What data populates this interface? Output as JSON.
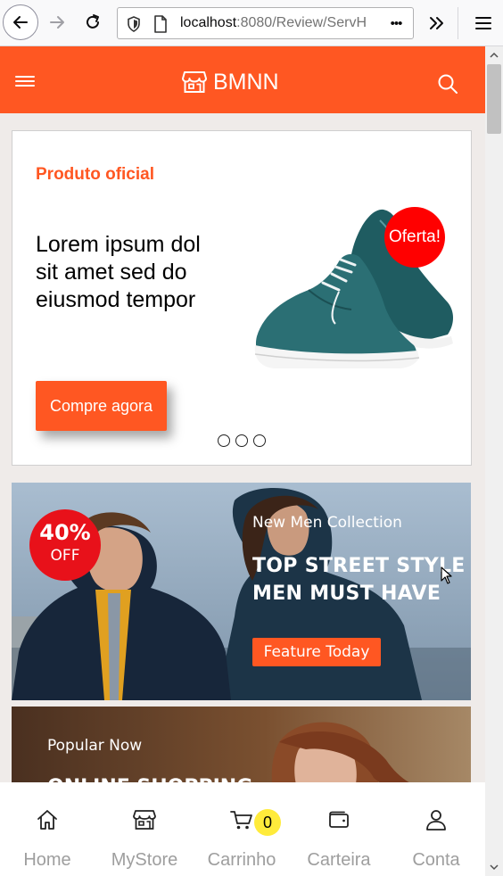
{
  "browser": {
    "url_host": "localhost",
    "url_rest": ":8080/Review/ServH",
    "url_overflow_menu": "•••"
  },
  "header": {
    "brand": "BMNN"
  },
  "hero": {
    "kicker": "Produto oficial",
    "title": "Lorem ipsum dol sit amet sed do eiusmod tempor",
    "cta": "Compre agora",
    "badge": "Oferta!",
    "slides": 3
  },
  "banner1": {
    "discount_pct": "40%",
    "discount_off": "OFF",
    "kicker": "New Men Collection",
    "headline_line1": "TOP STREET STYLE",
    "headline_line2": "MEN MUST HAVE",
    "cta": "Feature Today"
  },
  "banner2": {
    "kicker": "Popular Now",
    "headline": "ONLINE SHOPPING"
  },
  "bottom_nav": {
    "items": [
      {
        "label": "Home",
        "icon": "home-icon"
      },
      {
        "label": "MyStore",
        "icon": "store-icon"
      },
      {
        "label": "Carrinho",
        "icon": "cart-icon"
      },
      {
        "label": "Carteira",
        "icon": "wallet-icon"
      },
      {
        "label": "Conta",
        "icon": "user-icon"
      }
    ],
    "cart_count": "0"
  },
  "colors": {
    "accent": "#ff5722",
    "badge_red": "#ff0000",
    "cart_badge": "#ffeb3b",
    "page_bg": "#efebe9",
    "nav_label": "#9e9e9e"
  }
}
